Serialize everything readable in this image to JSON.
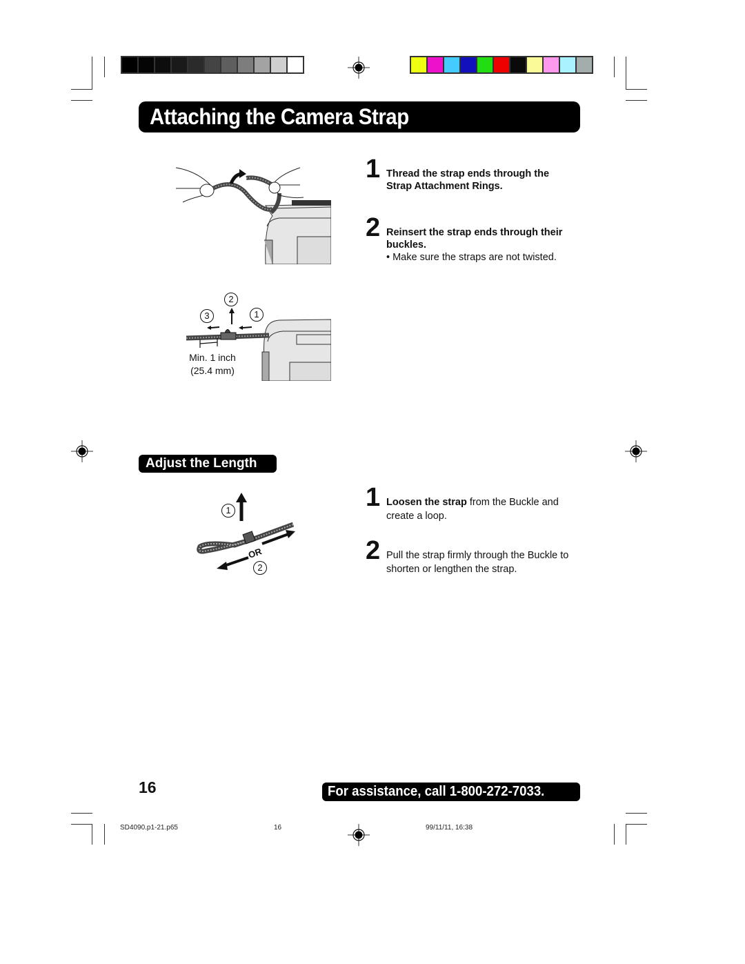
{
  "registration": {
    "grayscale_swatches": [
      "#000000",
      "#050505",
      "#0d0d0d",
      "#1a1a1a",
      "#2b2b2b",
      "#444444",
      "#5e5e5e",
      "#7d7d7d",
      "#a3a3a3",
      "#cfcfcf",
      "#ffffff"
    ],
    "color_swatches": [
      "#eeff11",
      "#ee11cc",
      "#44ccff",
      "#1111bb",
      "#22dd11",
      "#ee0000",
      "#0a0a0a",
      "#fafa99",
      "#ff99ee",
      "#aaf2ff",
      "#a3adab"
    ]
  },
  "header": {
    "title": "Attaching the Camera Strap"
  },
  "section1": {
    "steps": [
      {
        "number": "1",
        "text_bold": "Thread the strap ends through the Strap Attachment Rings."
      },
      {
        "number": "2",
        "text_bold": "Reinsert the strap ends through their buckles.",
        "note": "• Make sure the straps are not twisted."
      }
    ],
    "figure1": {
      "alt": "Hands threading strap through attachment ring on camera"
    },
    "figure2": {
      "labels": [
        "2",
        "3",
        "1"
      ],
      "caption_line1": "Min. 1 inch",
      "caption_line2": "(25.4 mm)"
    }
  },
  "section2": {
    "heading": "Adjust the Length",
    "figure": {
      "labels": [
        "1",
        "2"
      ],
      "or_label": "OR"
    },
    "steps": [
      {
        "number": "1",
        "text_bold": "Loosen the strap",
        "text_rest": " from the Buckle and create a loop."
      },
      {
        "number": "2",
        "text_rest": "Pull the strap firmly through the Buckle to shorten or lengthen the strap."
      }
    ]
  },
  "footer": {
    "page_number": "16",
    "assistance": "For assistance, call 1-800-272-7033.",
    "file_name": "SD4090.p1-21.p65",
    "file_page": "16",
    "timestamp": "99/11/11, 16:38"
  }
}
